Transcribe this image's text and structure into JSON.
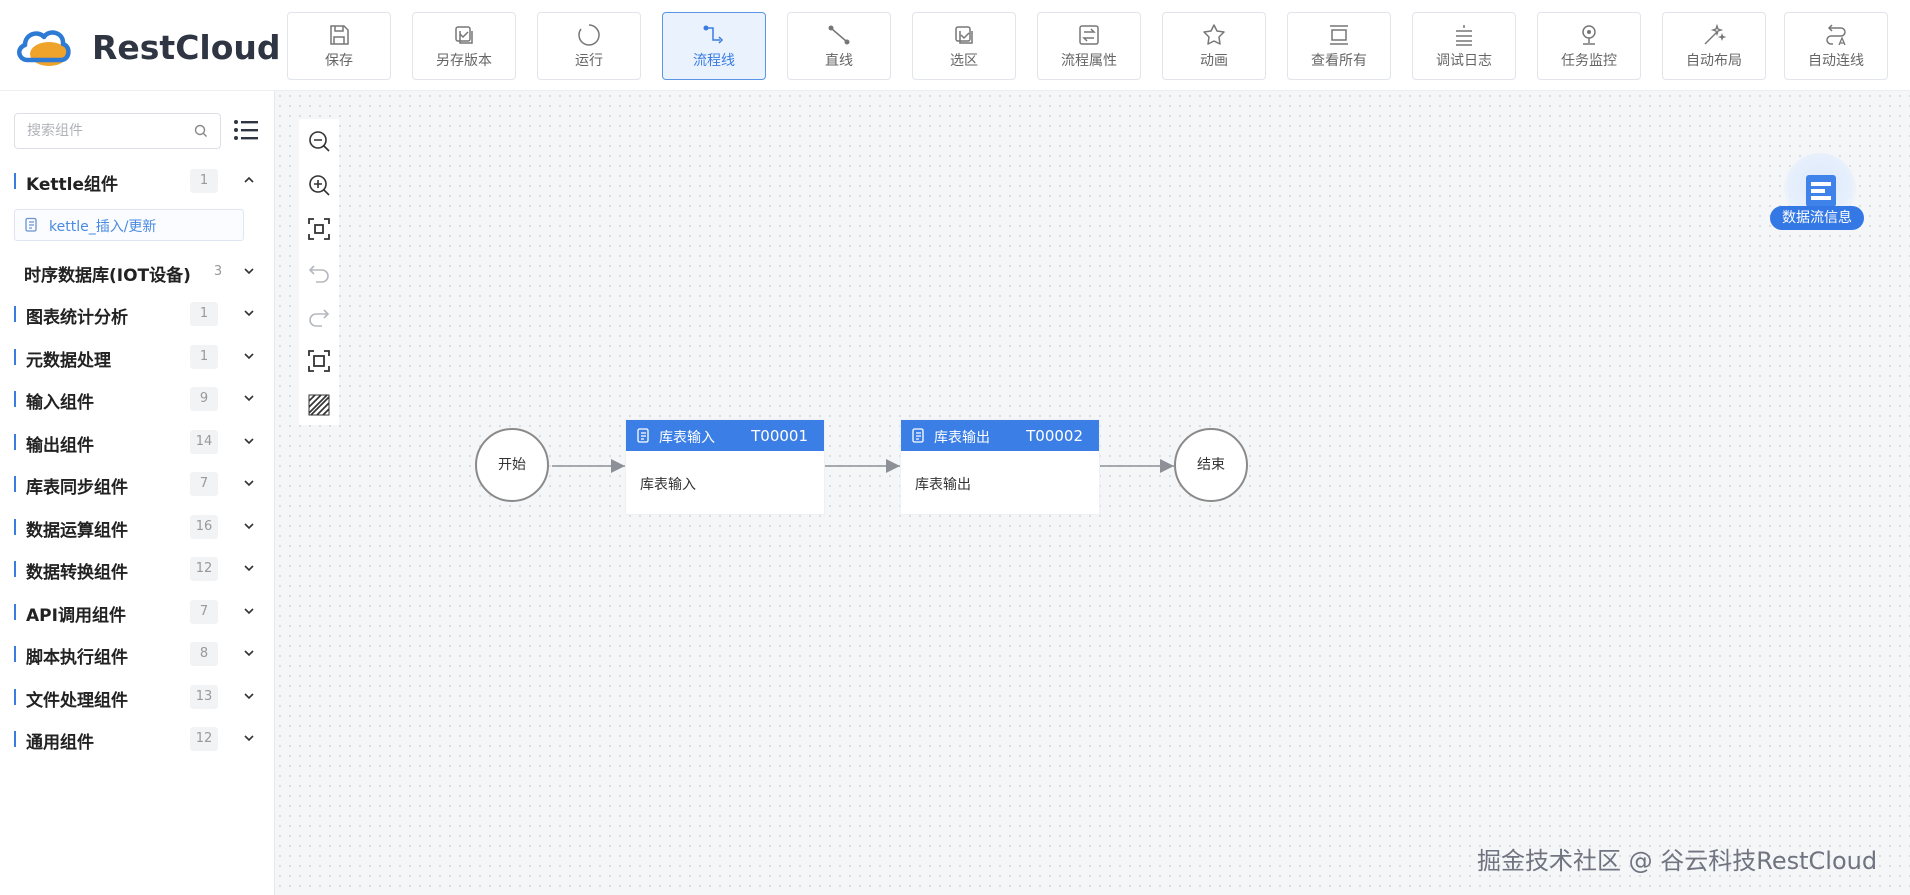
{
  "brand": {
    "name": "RestCloud"
  },
  "toolbar": [
    {
      "label": "保存",
      "icon": "save-icon"
    },
    {
      "label": "另存版本",
      "icon": "save-version-icon"
    },
    {
      "label": "运行",
      "icon": "run-icon"
    },
    {
      "label": "流程线",
      "icon": "flow-line-icon",
      "active": true
    },
    {
      "label": "直线",
      "icon": "straight-line-icon"
    },
    {
      "label": "选区",
      "icon": "select-area-icon"
    },
    {
      "label": "流程属性",
      "icon": "flow-properties-icon"
    },
    {
      "label": "动画",
      "icon": "animation-icon"
    },
    {
      "label": "查看所有",
      "icon": "view-all-icon"
    },
    {
      "label": "调试日志",
      "icon": "debug-log-icon"
    },
    {
      "label": "任务监控",
      "icon": "task-monitor-icon"
    },
    {
      "label": "自动布局",
      "icon": "auto-layout-icon"
    },
    {
      "label": "自动连线",
      "icon": "auto-connect-icon"
    }
  ],
  "sidebar": {
    "search_placeholder": "搜索组件",
    "categories": [
      {
        "name": "Kettle组件",
        "count": "1",
        "expanded": true
      },
      {
        "name": "时序数据库(IOT设备)",
        "count": "3"
      },
      {
        "name": "图表统计分析",
        "count": "1"
      },
      {
        "name": "元数据处理",
        "count": "1"
      },
      {
        "name": "输入组件",
        "count": "9"
      },
      {
        "name": "输出组件",
        "count": "14"
      },
      {
        "name": "库表同步组件",
        "count": "7"
      },
      {
        "name": "数据运算组件",
        "count": "16"
      },
      {
        "name": "数据转换组件",
        "count": "12"
      },
      {
        "name": "API调用组件",
        "count": "7"
      },
      {
        "name": "脚本执行组件",
        "count": "8"
      },
      {
        "name": "文件处理组件",
        "count": "13"
      },
      {
        "name": "通用组件",
        "count": "12"
      }
    ],
    "expanded_item": "kettle_插入/更新"
  },
  "flow": {
    "start_label": "开始",
    "end_label": "结束",
    "nodes": [
      {
        "title": "库表输入",
        "id": "T00001",
        "body": "库表输入"
      },
      {
        "title": "库表输出",
        "id": "T00002",
        "body": "库表输出"
      }
    ]
  },
  "info_badge": {
    "label": "数据流信息"
  },
  "watermark": "掘金技术社区 @ 谷云科技RestCloud",
  "colors": {
    "accent": "#3b7ee6",
    "active_bg": "#eaf2fd",
    "canvas_bg": "#f5f6f8"
  }
}
